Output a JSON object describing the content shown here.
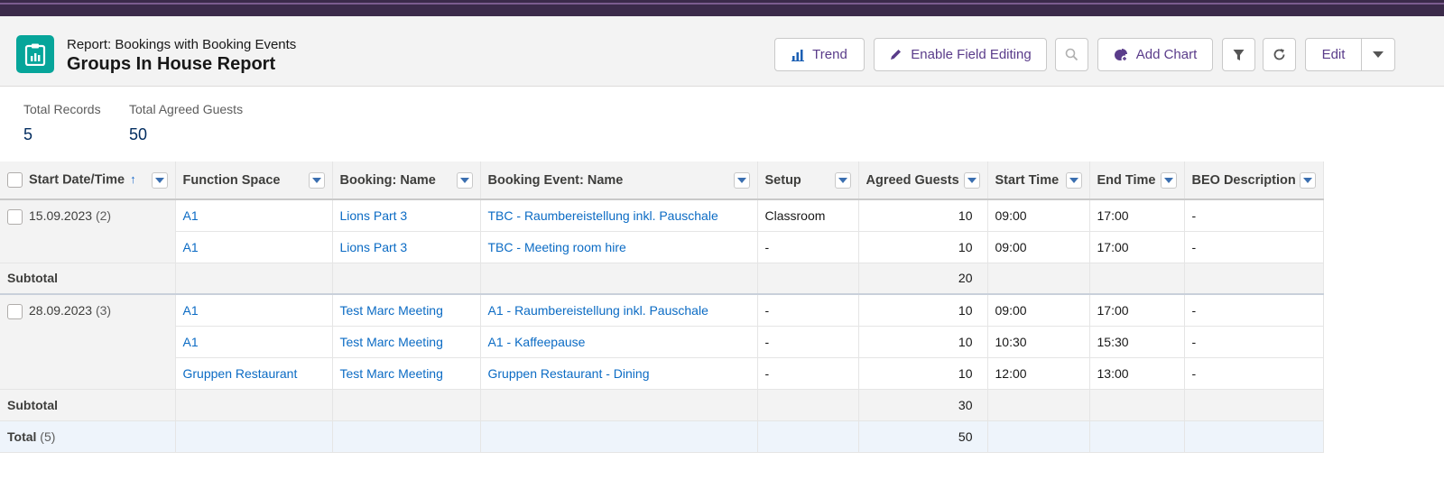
{
  "header": {
    "subtitle": "Report: Bookings with Booking Events",
    "title": "Groups In House Report",
    "buttons": {
      "trend": "Trend",
      "enable_field_editing": "Enable Field Editing",
      "add_chart": "Add Chart",
      "edit": "Edit"
    }
  },
  "stats": {
    "total_records_label": "Total Records",
    "total_records_value": "5",
    "total_agreed_guests_label": "Total Agreed Guests",
    "total_agreed_guests_value": "50"
  },
  "table": {
    "columns": [
      "Start Date/Time",
      "Function Space",
      "Booking: Name",
      "Booking Event: Name",
      "Setup",
      "Agreed Guests",
      "Start Time",
      "End Time",
      "BEO Description"
    ],
    "groups": [
      {
        "date": "15.09.2023",
        "count": "(2)",
        "rows": [
          {
            "function_space": "A1",
            "booking_name": "Lions Part 3",
            "event_name": "TBC - Raumbereistellung inkl. Pauschale",
            "setup": "Classroom",
            "guests": "10",
            "start": "09:00",
            "end": "17:00",
            "beo": "-"
          },
          {
            "function_space": "A1",
            "booking_name": "Lions Part 3",
            "event_name": "TBC - Meeting room hire",
            "setup": "-",
            "guests": "10",
            "start": "09:00",
            "end": "17:00",
            "beo": "-"
          }
        ],
        "subtotal_label": "Subtotal",
        "subtotal_value": "20"
      },
      {
        "date": "28.09.2023",
        "count": "(3)",
        "rows": [
          {
            "function_space": "A1",
            "booking_name": "Test Marc Meeting",
            "event_name": "A1 - Raumbereistellung inkl. Pauschale",
            "setup": "-",
            "guests": "10",
            "start": "09:00",
            "end": "17:00",
            "beo": "-"
          },
          {
            "function_space": "A1",
            "booking_name": "Test Marc Meeting",
            "event_name": "A1 - Kaffeepause",
            "setup": "-",
            "guests": "10",
            "start": "10:30",
            "end": "15:30",
            "beo": "-"
          },
          {
            "function_space": "Gruppen Restaurant",
            "booking_name": "Test Marc Meeting",
            "event_name": "Gruppen Restaurant - Dining",
            "setup": "-",
            "guests": "10",
            "start": "12:00",
            "end": "13:00",
            "beo": "-"
          }
        ],
        "subtotal_label": "Subtotal",
        "subtotal_value": "30"
      }
    ],
    "total_label": "Total",
    "total_count": "(5)",
    "total_value": "50"
  },
  "colors": {
    "brand_icon": "#06a59a",
    "link": "#0b6bc4",
    "button_text": "#5a3c8a",
    "topbar": "#3b2a4a"
  }
}
